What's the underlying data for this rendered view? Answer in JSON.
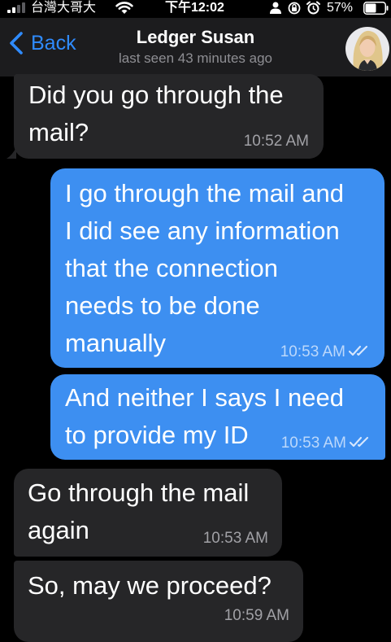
{
  "status_bar": {
    "carrier": "台灣大哥大",
    "time": "下午12:02",
    "battery": "57%"
  },
  "header": {
    "back_label": "Back",
    "contact_name": "Ledger Susan",
    "last_seen": "last seen 43 minutes ago"
  },
  "colors": {
    "incoming_bubble": "#262628",
    "outgoing_bubble": "#3d8ff1",
    "accent": "#2f8bff"
  },
  "messages": [
    {
      "direction": "incoming",
      "text": "Did you go through the\nmail?",
      "time": "10:52 AM"
    },
    {
      "direction": "outgoing",
      "text": "I go through the mail and\nI did see any information\nthat the connection\nneeds to be done\nmanually",
      "time": "10:53 AM",
      "status": "read"
    },
    {
      "direction": "outgoing",
      "text": "And neither I says I need\nto provide my ID",
      "time": "10:53 AM",
      "status": "read"
    },
    {
      "direction": "incoming",
      "text": "Go through the mail\nagain",
      "time": "10:53 AM"
    },
    {
      "direction": "incoming",
      "text": "So, may we proceed?",
      "time": "10:59 AM"
    }
  ]
}
